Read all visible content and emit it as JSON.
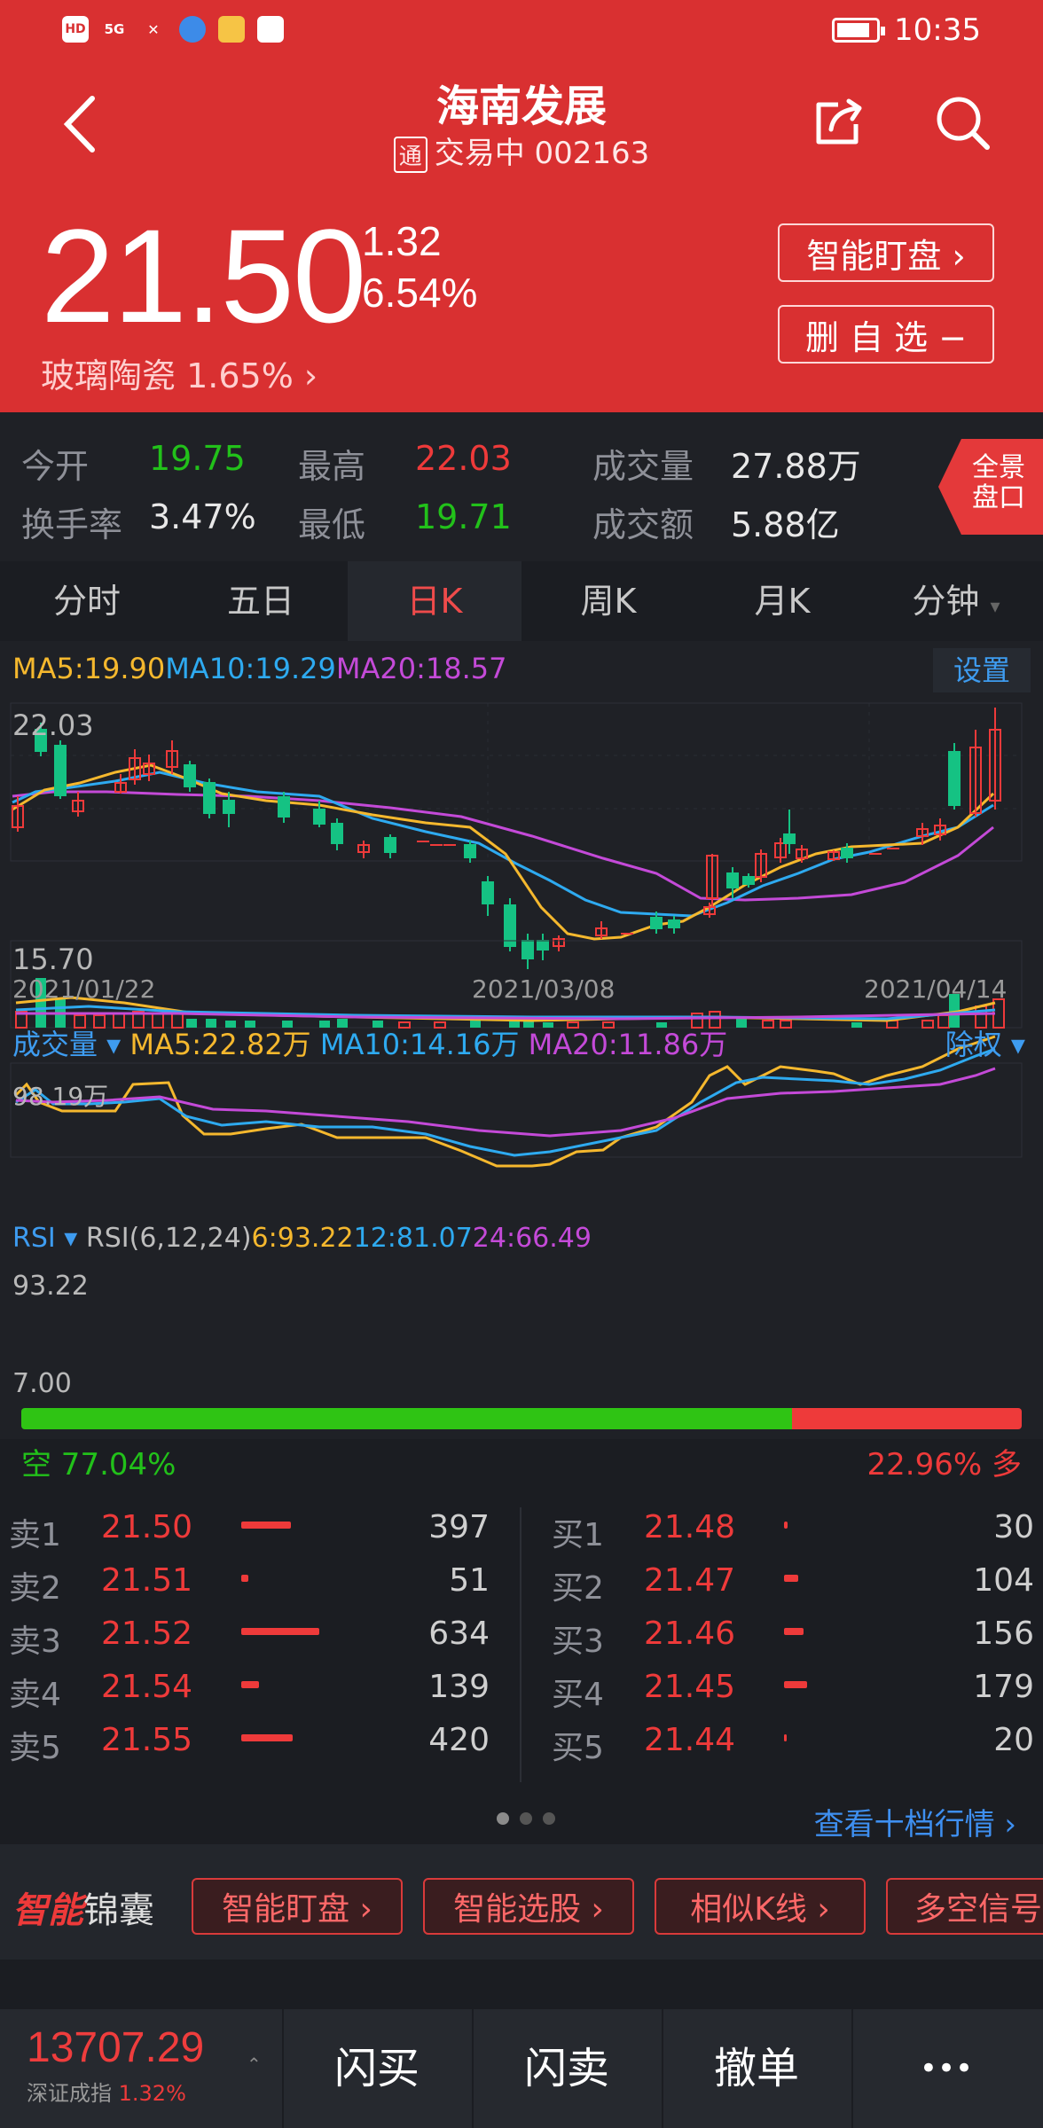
{
  "status": {
    "time": "10:35",
    "network": "5G"
  },
  "header": {
    "title": "海南发展",
    "tong_badge": "通",
    "subtitle": "交易中 002163",
    "price": "21.50",
    "change": "1.32",
    "change_pct": "6.54%",
    "sector": "玻璃陶瓷 1.65%",
    "btn_monitor": "智能盯盘 ›",
    "btn_remove": "删 自 选 −"
  },
  "stats": {
    "open_label": "今开",
    "open": "19.75",
    "high_label": "最高",
    "high": "22.03",
    "vol_label": "成交量",
    "vol": "27.88万",
    "turnover_label": "换手率",
    "turnover": "3.47%",
    "low_label": "最低",
    "low": "19.71",
    "amount_label": "成交额",
    "amount": "5.88亿",
    "fullview": "全景盘口"
  },
  "tabs": [
    "分时",
    "五日",
    "日K",
    "周K",
    "月K",
    "分钟"
  ],
  "kline": {
    "ma5": "MA5:19.90",
    "ma10": "MA10:19.29",
    "ma20": "MA20:18.57",
    "settings": "设置",
    "max_label": "22.03",
    "min_label": "15.70",
    "dates": [
      "2021/01/22",
      "2021/03/08",
      "2021/04/14"
    ]
  },
  "volume": {
    "title": "成交量 ▾",
    "ma5": "MA5:22.82万",
    "ma10": "MA10:14.16万",
    "ma20": "MA20:11.86万",
    "adjust": "除权 ▾",
    "max_label": "98.19万"
  },
  "rsi": {
    "title": "RSI ▾",
    "params": "RSI(6,12,24)",
    "r6": "6:93.22",
    "r12": "12:81.07",
    "r24": "24:66.49",
    "max_label": "93.22",
    "min_label": "7.00"
  },
  "sentiment": {
    "bear_label": "空  77.04%",
    "bull_label": "22.96%  多",
    "bear_pct": 77.04
  },
  "orderbook": {
    "sell": [
      {
        "label": "卖1",
        "price": "21.50",
        "vol": "397"
      },
      {
        "label": "卖2",
        "price": "21.51",
        "vol": "51"
      },
      {
        "label": "卖3",
        "price": "21.52",
        "vol": "634"
      },
      {
        "label": "卖4",
        "price": "21.54",
        "vol": "139"
      },
      {
        "label": "卖5",
        "price": "21.55",
        "vol": "420"
      }
    ],
    "buy": [
      {
        "label": "买1",
        "price": "21.48",
        "vol": "30"
      },
      {
        "label": "买2",
        "price": "21.47",
        "vol": "104"
      },
      {
        "label": "买3",
        "price": "21.46",
        "vol": "156"
      },
      {
        "label": "买4",
        "price": "21.45",
        "vol": "179"
      },
      {
        "label": "买5",
        "price": "21.44",
        "vol": "20"
      }
    ],
    "more": "查看十档行情 ›"
  },
  "smart": {
    "logo_a": "智能",
    "logo_b": "锦囊",
    "buttons": [
      "智能盯盘 ›",
      "智能选股 ›",
      "相似K线 ›",
      "多空信号"
    ]
  },
  "bottom": {
    "index_value": "13707.29",
    "index_name": "深证成指",
    "index_pct": "1.32%",
    "buy": "闪买",
    "sell": "闪卖",
    "cancel": "撤单",
    "more": "•••"
  },
  "colors": {
    "header_red": "#d93031",
    "up": "#ee3a3a",
    "down": "#22c11a",
    "ma5": "#f5b82e",
    "ma10": "#2eaaf0",
    "ma20": "#c44ad8"
  }
}
